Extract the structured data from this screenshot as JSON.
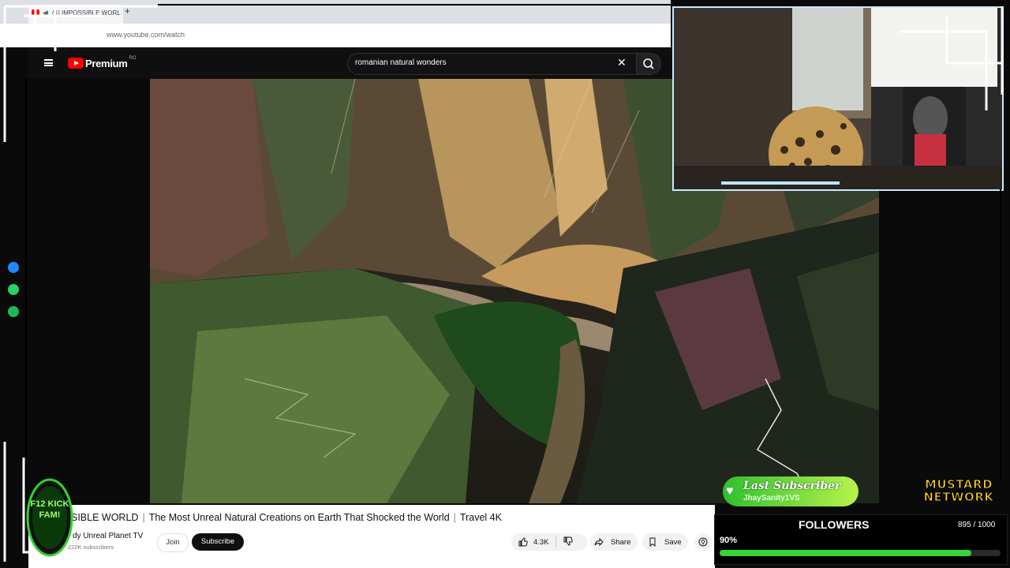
{
  "browser": {
    "tab_title": "(4) IMPOSSIBLE WORL",
    "new_tab_glyph": "+",
    "url": "www.youtube.com/watch"
  },
  "youtube": {
    "logo_text": "Premium",
    "country_code": "RO",
    "search_query": "romanian natural wonders",
    "clear_glyph": "✕"
  },
  "video": {
    "title_prefix": "SIBLE WORLD",
    "title_main": "The Most Unreal Natural Creations on Earth That Shocked the World",
    "title_suffix": "Travel 4K",
    "separator": "|",
    "channel": "dy Unreal Planet TV",
    "subscribers": "222K subscribers",
    "join_label": "Join",
    "subscribe_label": "Subscribe",
    "likes": "4.3K",
    "share_label": "Share",
    "save_label": "Save"
  },
  "overlay": {
    "last_subscriber_title": "Last Subscriber",
    "last_subscriber_name": "JhaySanity1VS",
    "followers_label": "FOLLOWERS",
    "followers_count": "895 / 1000",
    "followers_percent_text": "90%",
    "followers_progress": 0.895,
    "brand_line1": "MUSTARD",
    "brand_line2": "NETWORK",
    "badge_text": "F12 KICK FAM!"
  },
  "colors": {
    "youtube_red": "#ff0000",
    "progress_green": "#37d43a",
    "brand_yellow": "#ffd21f"
  }
}
